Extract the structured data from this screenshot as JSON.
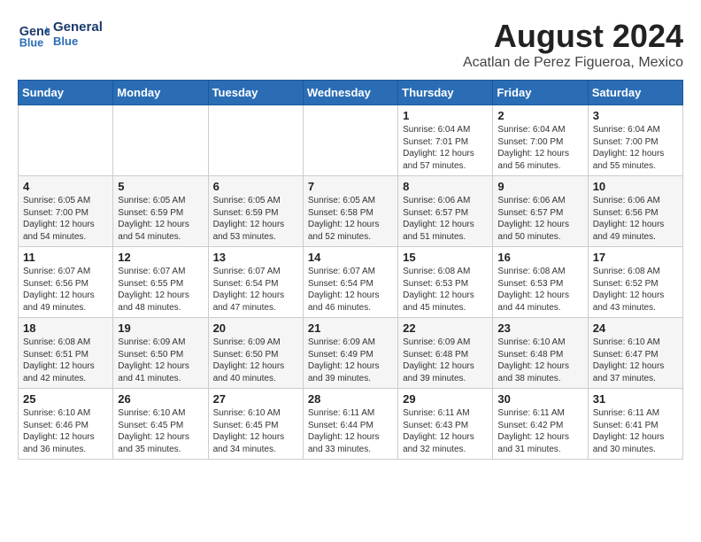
{
  "header": {
    "logo_line1": "General",
    "logo_line2": "Blue",
    "month": "August 2024",
    "location": "Acatlan de Perez Figueroa, Mexico"
  },
  "weekdays": [
    "Sunday",
    "Monday",
    "Tuesday",
    "Wednesday",
    "Thursday",
    "Friday",
    "Saturday"
  ],
  "weeks": [
    [
      {
        "day": "",
        "info": ""
      },
      {
        "day": "",
        "info": ""
      },
      {
        "day": "",
        "info": ""
      },
      {
        "day": "",
        "info": ""
      },
      {
        "day": "1",
        "info": "Sunrise: 6:04 AM\nSunset: 7:01 PM\nDaylight: 12 hours\nand 57 minutes."
      },
      {
        "day": "2",
        "info": "Sunrise: 6:04 AM\nSunset: 7:00 PM\nDaylight: 12 hours\nand 56 minutes."
      },
      {
        "day": "3",
        "info": "Sunrise: 6:04 AM\nSunset: 7:00 PM\nDaylight: 12 hours\nand 55 minutes."
      }
    ],
    [
      {
        "day": "4",
        "info": "Sunrise: 6:05 AM\nSunset: 7:00 PM\nDaylight: 12 hours\nand 54 minutes."
      },
      {
        "day": "5",
        "info": "Sunrise: 6:05 AM\nSunset: 6:59 PM\nDaylight: 12 hours\nand 54 minutes."
      },
      {
        "day": "6",
        "info": "Sunrise: 6:05 AM\nSunset: 6:59 PM\nDaylight: 12 hours\nand 53 minutes."
      },
      {
        "day": "7",
        "info": "Sunrise: 6:05 AM\nSunset: 6:58 PM\nDaylight: 12 hours\nand 52 minutes."
      },
      {
        "day": "8",
        "info": "Sunrise: 6:06 AM\nSunset: 6:57 PM\nDaylight: 12 hours\nand 51 minutes."
      },
      {
        "day": "9",
        "info": "Sunrise: 6:06 AM\nSunset: 6:57 PM\nDaylight: 12 hours\nand 50 minutes."
      },
      {
        "day": "10",
        "info": "Sunrise: 6:06 AM\nSunset: 6:56 PM\nDaylight: 12 hours\nand 49 minutes."
      }
    ],
    [
      {
        "day": "11",
        "info": "Sunrise: 6:07 AM\nSunset: 6:56 PM\nDaylight: 12 hours\nand 49 minutes."
      },
      {
        "day": "12",
        "info": "Sunrise: 6:07 AM\nSunset: 6:55 PM\nDaylight: 12 hours\nand 48 minutes."
      },
      {
        "day": "13",
        "info": "Sunrise: 6:07 AM\nSunset: 6:54 PM\nDaylight: 12 hours\nand 47 minutes."
      },
      {
        "day": "14",
        "info": "Sunrise: 6:07 AM\nSunset: 6:54 PM\nDaylight: 12 hours\nand 46 minutes."
      },
      {
        "day": "15",
        "info": "Sunrise: 6:08 AM\nSunset: 6:53 PM\nDaylight: 12 hours\nand 45 minutes."
      },
      {
        "day": "16",
        "info": "Sunrise: 6:08 AM\nSunset: 6:53 PM\nDaylight: 12 hours\nand 44 minutes."
      },
      {
        "day": "17",
        "info": "Sunrise: 6:08 AM\nSunset: 6:52 PM\nDaylight: 12 hours\nand 43 minutes."
      }
    ],
    [
      {
        "day": "18",
        "info": "Sunrise: 6:08 AM\nSunset: 6:51 PM\nDaylight: 12 hours\nand 42 minutes."
      },
      {
        "day": "19",
        "info": "Sunrise: 6:09 AM\nSunset: 6:50 PM\nDaylight: 12 hours\nand 41 minutes."
      },
      {
        "day": "20",
        "info": "Sunrise: 6:09 AM\nSunset: 6:50 PM\nDaylight: 12 hours\nand 40 minutes."
      },
      {
        "day": "21",
        "info": "Sunrise: 6:09 AM\nSunset: 6:49 PM\nDaylight: 12 hours\nand 39 minutes."
      },
      {
        "day": "22",
        "info": "Sunrise: 6:09 AM\nSunset: 6:48 PM\nDaylight: 12 hours\nand 39 minutes."
      },
      {
        "day": "23",
        "info": "Sunrise: 6:10 AM\nSunset: 6:48 PM\nDaylight: 12 hours\nand 38 minutes."
      },
      {
        "day": "24",
        "info": "Sunrise: 6:10 AM\nSunset: 6:47 PM\nDaylight: 12 hours\nand 37 minutes."
      }
    ],
    [
      {
        "day": "25",
        "info": "Sunrise: 6:10 AM\nSunset: 6:46 PM\nDaylight: 12 hours\nand 36 minutes."
      },
      {
        "day": "26",
        "info": "Sunrise: 6:10 AM\nSunset: 6:45 PM\nDaylight: 12 hours\nand 35 minutes."
      },
      {
        "day": "27",
        "info": "Sunrise: 6:10 AM\nSunset: 6:45 PM\nDaylight: 12 hours\nand 34 minutes."
      },
      {
        "day": "28",
        "info": "Sunrise: 6:11 AM\nSunset: 6:44 PM\nDaylight: 12 hours\nand 33 minutes."
      },
      {
        "day": "29",
        "info": "Sunrise: 6:11 AM\nSunset: 6:43 PM\nDaylight: 12 hours\nand 32 minutes."
      },
      {
        "day": "30",
        "info": "Sunrise: 6:11 AM\nSunset: 6:42 PM\nDaylight: 12 hours\nand 31 minutes."
      },
      {
        "day": "31",
        "info": "Sunrise: 6:11 AM\nSunset: 6:41 PM\nDaylight: 12 hours\nand 30 minutes."
      }
    ]
  ]
}
